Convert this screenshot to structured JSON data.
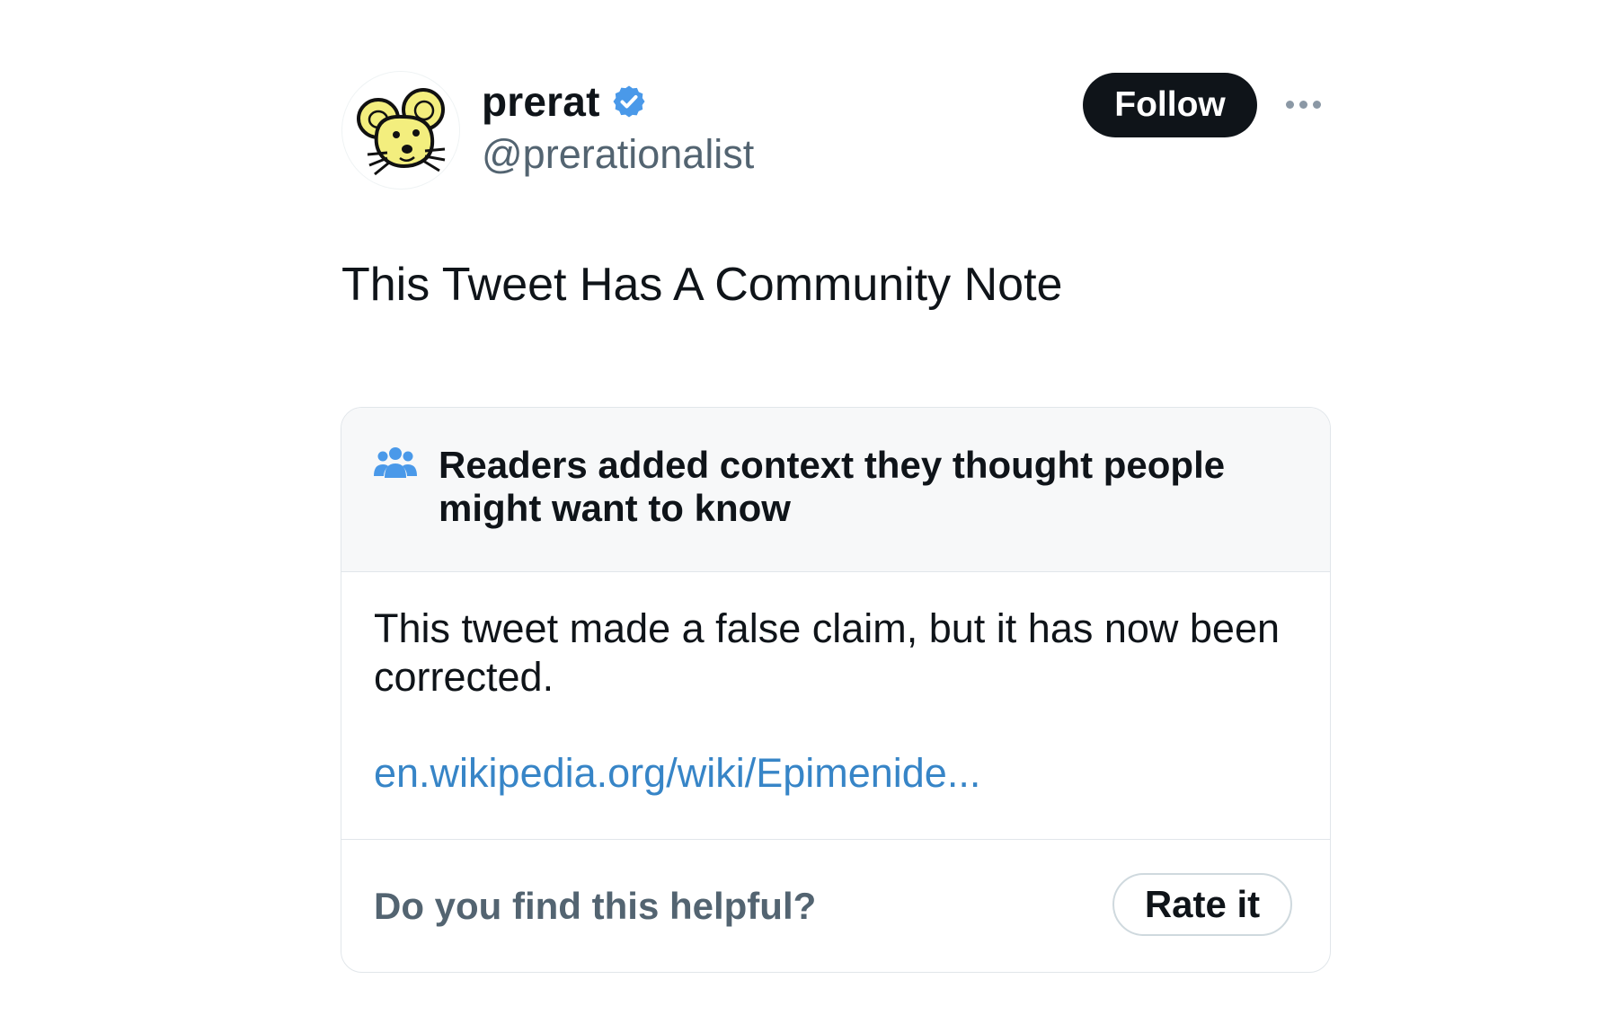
{
  "author": {
    "display_name": "prerat",
    "handle": "@prerationalist",
    "verified": true,
    "avatar_icon": "yellow-mouse-cartoon",
    "verified_icon": "verified-badge-icon"
  },
  "actions": {
    "follow_label": "Follow",
    "more_icon": "more-horizontal-icon"
  },
  "tweet": {
    "text": "This Tweet Has A Community Note"
  },
  "community_note": {
    "header_icon": "readers-people-icon",
    "header_title": "Readers added context they thought people might want to know",
    "body": "This tweet made a false claim, but it has now been corrected.",
    "link_text": "en.wikipedia.org/wiki/Epimenide...",
    "helpful_question": "Do you find this helpful?",
    "rate_label": "Rate it"
  },
  "colors": {
    "text_primary": "#0f1419",
    "text_secondary": "#536471",
    "verified_blue": "#4a99e9",
    "link_blue": "#3785c7",
    "header_bg": "#f7f8f9",
    "border": "#e1e6ea",
    "avatar_yellow": "#f3ee7e"
  }
}
